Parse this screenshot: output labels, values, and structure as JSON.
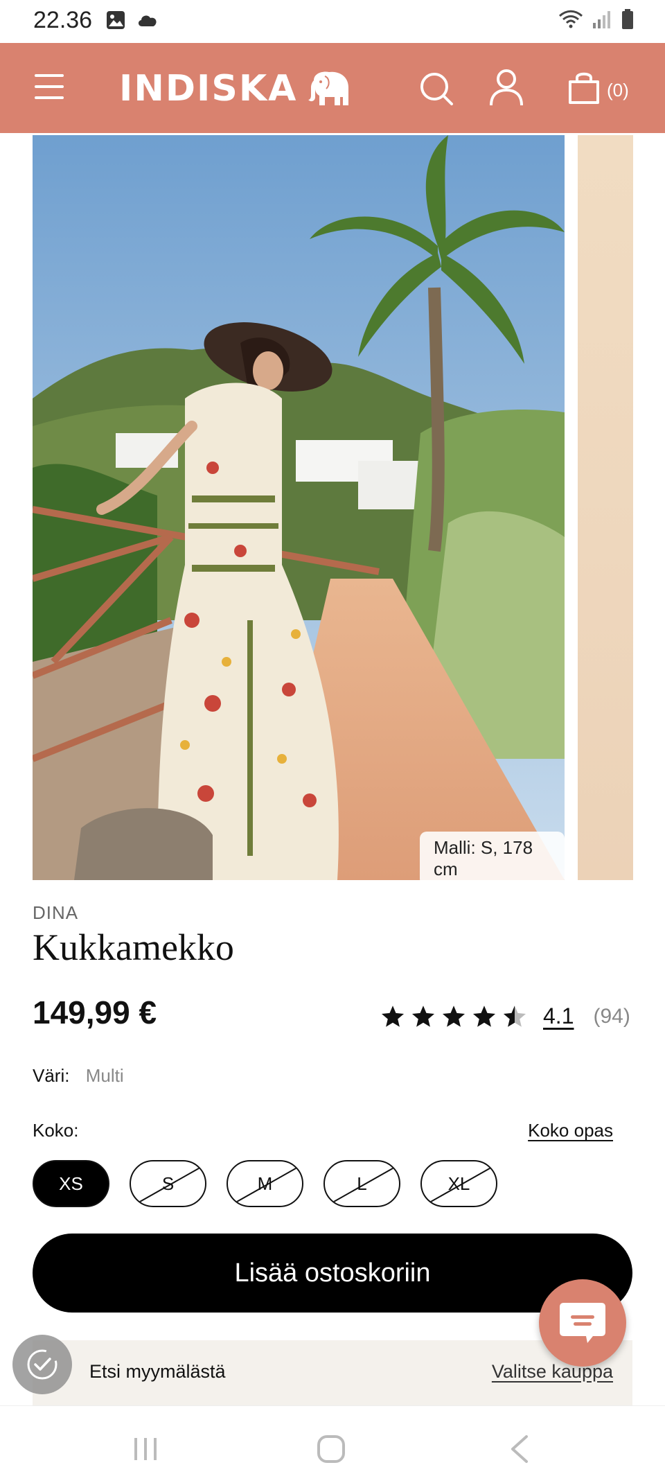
{
  "status_bar": {
    "time": "22.36",
    "icons": [
      "image-icon",
      "cloud-icon",
      "wifi-icon",
      "signal-icon",
      "battery-icon"
    ]
  },
  "header": {
    "logo_text": "INDISKA",
    "cart_count": "(0)",
    "background_color": "#d9826f",
    "icons": [
      "menu-icon",
      "elephant-logo",
      "search-icon",
      "user-icon",
      "cart-icon"
    ]
  },
  "gallery": {
    "model_info": "Malli: S, 178 cm"
  },
  "product": {
    "brand": "DINA",
    "title": "Kukkamekko",
    "price": "149,99 €",
    "rating": {
      "stars": 4.5,
      "value": "4.1",
      "count": "(94)"
    },
    "color_label": "Väri:",
    "color_value": "Multi",
    "size_label": "Koko:",
    "size_guide": "Koko opas",
    "sizes": [
      {
        "label": "XS",
        "selected": true,
        "available": true
      },
      {
        "label": "S",
        "selected": false,
        "available": false
      },
      {
        "label": "M",
        "selected": false,
        "available": false
      },
      {
        "label": "L",
        "selected": false,
        "available": false
      },
      {
        "label": "XL",
        "selected": false,
        "available": false
      }
    ],
    "add_to_cart": "Lisää ostoskoriin"
  },
  "store": {
    "label": "Etsi myymälästä",
    "select": "Valitse kauppa"
  },
  "nav_bar": {
    "icons": [
      "recent-apps-icon",
      "home-icon",
      "back-icon"
    ]
  }
}
